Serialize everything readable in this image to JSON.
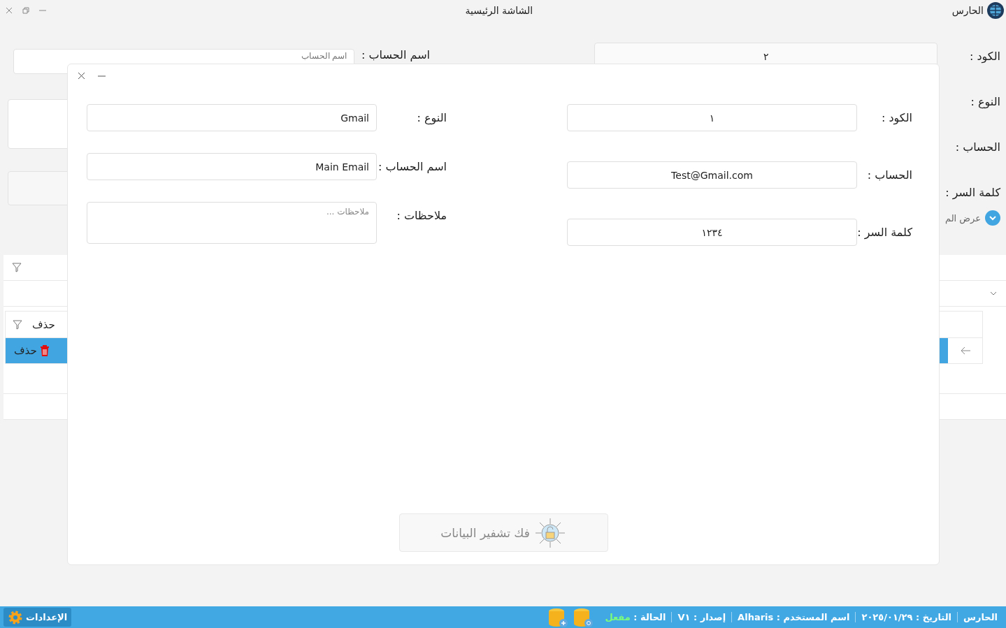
{
  "window": {
    "title": "الشاشة الرئيسية",
    "app_name": "الحارس"
  },
  "main_form": {
    "code_label": "الكود :",
    "code_value": "٢",
    "type_label": "النوع :",
    "account_label": "الحساب :",
    "password_label": "كلمة السر :",
    "account_name_label": "اسم الحساب :",
    "account_name_placeholder": "اسم الحساب",
    "toggle_label": "عرض الم"
  },
  "grid": {
    "column_header": "حذف",
    "rows": [
      {
        "action": "حذف",
        "selected": true
      }
    ]
  },
  "dialog": {
    "right_fields": [
      {
        "label": "الكود :",
        "value": "١"
      },
      {
        "label": "الحساب :",
        "value": "Test@Gmail.com"
      },
      {
        "label": "كلمة السر :",
        "value": "١٢٣٤"
      }
    ],
    "left_fields": [
      {
        "kind": "text",
        "label": "النوع :",
        "value": "Gmail"
      },
      {
        "kind": "text",
        "label": "اسم الحساب :",
        "value": "Main Email"
      },
      {
        "kind": "textarea",
        "label": "ملاحظات :",
        "placeholder": "ملاحظات ..."
      }
    ],
    "decrypt_button": "فك تشفير البيانات"
  },
  "status_bar": {
    "app": "الحارس",
    "date": "التاريخ : ٢٠٢٥/٠١/٢٩",
    "user": "اسم المستخدم : Alharis",
    "version": "إصدار : V١",
    "status_label": "الحالة :",
    "status_value": "مفعل",
    "settings": "الإعدادات"
  }
}
